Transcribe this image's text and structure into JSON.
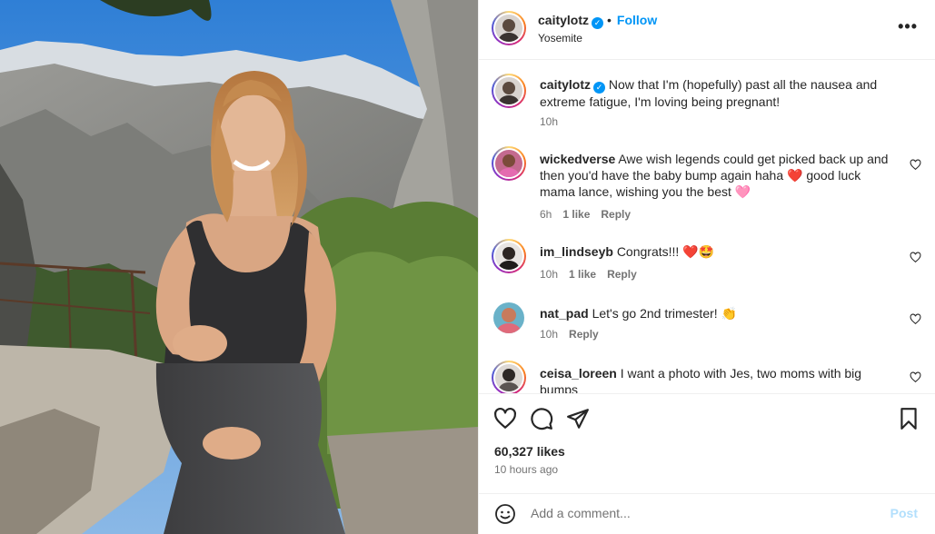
{
  "post": {
    "author": "caitylotz",
    "follow_label": "Follow",
    "separator": "•",
    "location": "Yosemite",
    "more_icon": "more-horizontal-icon",
    "caption": {
      "username": "caitylotz",
      "text": "Now that I'm (hopefully) past all the nausea and extreme fatigue, I'm loving being pregnant!",
      "time": "10h"
    }
  },
  "comments": [
    {
      "username": "wickedverse",
      "text": "Awe wish legends could get picked back up and then you'd have the baby bump again haha ❤️ good luck mama lance, wishing you the best 🩷",
      "time": "6h",
      "likes": "1 like",
      "reply": "Reply"
    },
    {
      "username": "im_lindseyb",
      "text": "Congrats!!! ❤️🤩",
      "time": "10h",
      "likes": "1 like",
      "reply": "Reply"
    },
    {
      "username": "nat_pad",
      "text": "Let's go 2nd trimester! 👏",
      "time": "10h",
      "likes": "",
      "reply": "Reply"
    },
    {
      "username": "ceisa_loreen",
      "text": "I want a photo with Jes, two moms with big bumps",
      "time": "",
      "likes": "",
      "reply": ""
    }
  ],
  "actions": {
    "icons": [
      "heart-icon",
      "comment-icon",
      "share-icon",
      "bookmark-icon"
    ],
    "likes_count": "60,327 likes",
    "time_ago": "10 hours ago"
  },
  "add_comment": {
    "placeholder": "Add a comment...",
    "post_label": "Post"
  },
  "colors": {
    "accent": "#0095f6",
    "text": "#262626",
    "muted": "#737373",
    "post_disabled": "#b2dffc"
  }
}
